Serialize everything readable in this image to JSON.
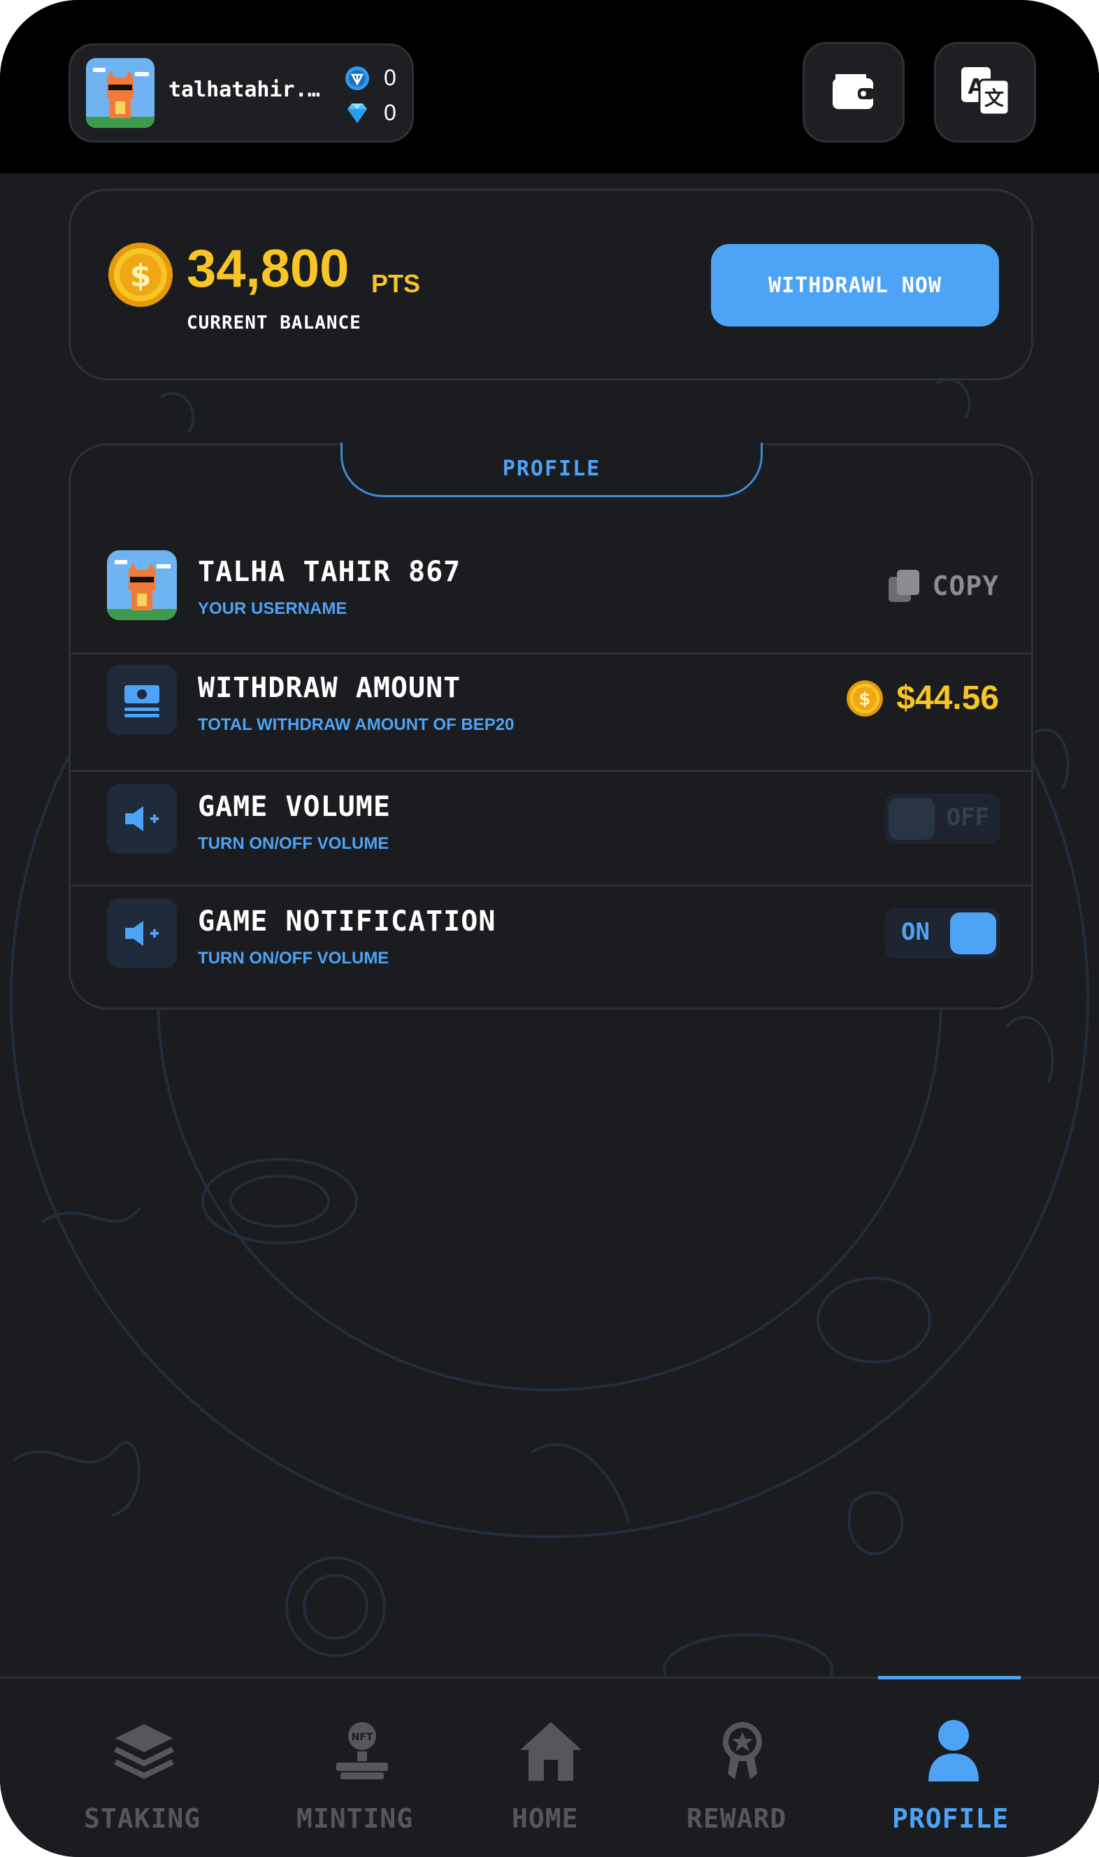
{
  "header": {
    "username": "talhatahir...",
    "ton_balance": "0",
    "gem_balance": "0",
    "wallet_icon": "wallet-icon",
    "translate_icon": "translate-icon"
  },
  "balance": {
    "value": "34,800",
    "unit": "PTS",
    "label": "CURRENT BALANCE",
    "withdraw_button": "WITHDRAWL NOW"
  },
  "profile": {
    "tab_label": "PROFILE",
    "username_row": {
      "title": "TALHA TAHIR 867",
      "subtitle": "YOUR USERNAME",
      "copy_label": "COPY"
    },
    "withdraw_row": {
      "title": "WITHDRAW AMOUNT",
      "subtitle": "TOTAL WITHDRAW AMOUNT OF BEP20",
      "amount": "$44.56"
    },
    "volume_row": {
      "title": "GAME VOLUME",
      "subtitle": "TURN ON/OFF VOLUME",
      "toggle_label": "OFF",
      "toggle_state": "off"
    },
    "notification_row": {
      "title": "GAME NOTIFICATION",
      "subtitle": "TURN ON/OFF VOLUME",
      "toggle_label": "ON",
      "toggle_state": "on"
    }
  },
  "nav": {
    "items": [
      {
        "label": "STAKING",
        "icon": "layers-icon"
      },
      {
        "label": "MINTING",
        "icon": "nft-minting-icon"
      },
      {
        "label": "HOME",
        "icon": "home-icon"
      },
      {
        "label": "REWARD",
        "icon": "reward-medal-icon"
      },
      {
        "label": "PROFILE",
        "icon": "user-icon"
      }
    ],
    "active": "PROFILE"
  },
  "colors": {
    "accent": "#4da3f5",
    "gold": "#f7c526",
    "background": "#1b1c1f",
    "card_border": "#2f3034"
  }
}
